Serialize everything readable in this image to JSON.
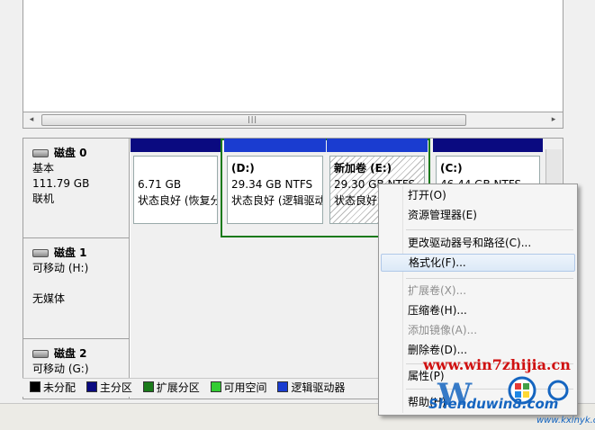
{
  "scroll": {
    "grip": "|||",
    "left_arrow": "◂",
    "right_arrow": "▸"
  },
  "disks": [
    {
      "name": "磁盘 0",
      "type": "基本",
      "size": "111.79 GB",
      "status": "联机"
    },
    {
      "name": "磁盘 1",
      "type": "可移动 (H:)",
      "media": "无媒体"
    },
    {
      "name": "磁盘 2",
      "type": "可移动 (G:)"
    }
  ],
  "partitions": [
    {
      "title": "",
      "size": "6.71 GB",
      "status": "状态良好 (恢复分"
    },
    {
      "title": "(D:)",
      "size": "29.34 GB NTFS",
      "status": "状态良好 (逻辑驱动"
    },
    {
      "title": "新加卷  (E:)",
      "size": "29.30 GB NTFS",
      "status": "状态良好"
    },
    {
      "title": "(C:)",
      "size": "46.44 GB NTFS",
      "status": ""
    }
  ],
  "legend": [
    {
      "label": "未分配",
      "color": "#000000"
    },
    {
      "label": "主分区",
      "color": "#0a0a80"
    },
    {
      "label": "扩展分区",
      "color": "#1a7a1a"
    },
    {
      "label": "可用空间",
      "color": "#33cc33"
    },
    {
      "label": "逻辑驱动器",
      "color": "#1a3cd0"
    }
  ],
  "menu": {
    "open": "打开(O)",
    "explorer": "资源管理器(E)",
    "change_letter": "更改驱动器号和路径(C)...",
    "format": "格式化(F)...",
    "extend": "扩展卷(X)...",
    "shrink": "压缩卷(H)...",
    "mirror": "添加镜像(A)...",
    "delete": "删除卷(D)...",
    "properties": "属性(P)",
    "help": "帮助(H)"
  },
  "watermark": {
    "url": "www.win7zhijia.cn",
    "site": "Shenduwin8.com",
    "sub": "www.kxinyk.com"
  },
  "colors": {
    "primary": "#0a0a80",
    "logical": "#1a3cd0",
    "extended": "#1a7a1a"
  }
}
